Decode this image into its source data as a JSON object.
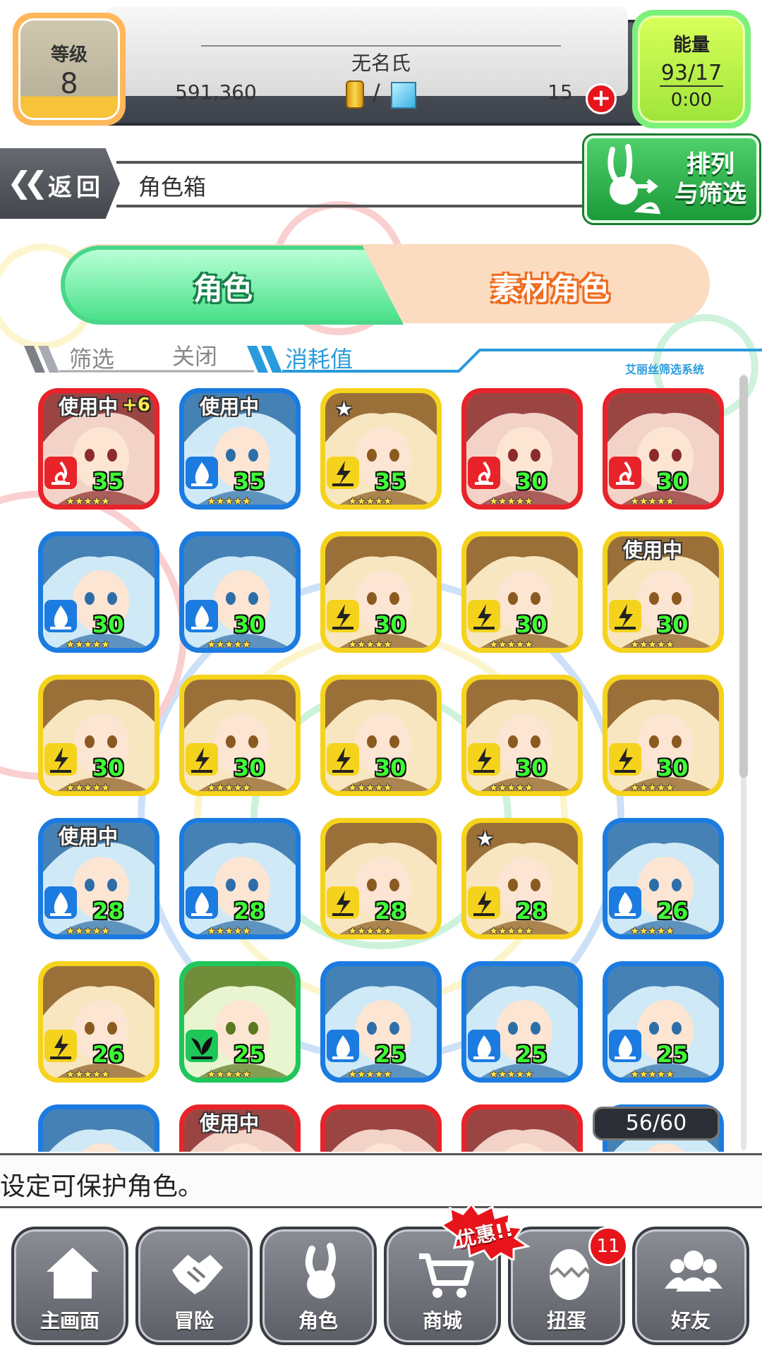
{
  "status": {
    "level_label": "等级",
    "level": "8",
    "username": "无名氏",
    "coins": "591,360",
    "separator": "/",
    "gems": "15",
    "energy_label": "能量",
    "energy": "93/17",
    "energy_timer": "0:00"
  },
  "header": {
    "back_label": "返回",
    "title": "角色箱",
    "sort_label_1": "排列",
    "sort_label_2": "与筛选"
  },
  "tabs": [
    {
      "label": "角色",
      "active": true
    },
    {
      "label": "素材角色",
      "active": false
    }
  ],
  "filter": {
    "filter_label": "筛选",
    "filter_state": "关闭",
    "sort_key": "消耗值",
    "system_label": "艾丽丝筛选系统"
  },
  "characters": [
    {
      "frame": "red",
      "element": "fire",
      "cost": "35",
      "in_use": "使用中",
      "plus": "+6"
    },
    {
      "frame": "blue",
      "element": "water",
      "cost": "35",
      "in_use": "使用中"
    },
    {
      "frame": "yellow",
      "element": "thunder",
      "cost": "35",
      "favorite": true
    },
    {
      "frame": "red",
      "element": "fire",
      "cost": "30"
    },
    {
      "frame": "red",
      "element": "fire",
      "cost": "30"
    },
    {
      "frame": "blue",
      "element": "water",
      "cost": "30"
    },
    {
      "frame": "blue",
      "element": "water",
      "cost": "30"
    },
    {
      "frame": "yellow",
      "element": "thunder",
      "cost": "30"
    },
    {
      "frame": "yellow",
      "element": "thunder",
      "cost": "30"
    },
    {
      "frame": "yellow",
      "element": "thunder",
      "cost": "30",
      "in_use": "使用中"
    },
    {
      "frame": "yellow",
      "element": "thunder",
      "cost": "30"
    },
    {
      "frame": "yellow",
      "element": "thunder",
      "cost": "30"
    },
    {
      "frame": "yellow",
      "element": "thunder",
      "cost": "30"
    },
    {
      "frame": "yellow",
      "element": "thunder",
      "cost": "30"
    },
    {
      "frame": "yellow",
      "element": "thunder",
      "cost": "30"
    },
    {
      "frame": "blue",
      "element": "water",
      "cost": "28",
      "in_use": "使用中"
    },
    {
      "frame": "blue",
      "element": "water",
      "cost": "28"
    },
    {
      "frame": "yellow",
      "element": "thunder",
      "cost": "28"
    },
    {
      "frame": "yellow",
      "element": "thunder",
      "cost": "28",
      "favorite": true
    },
    {
      "frame": "blue",
      "element": "water",
      "cost": "26"
    },
    {
      "frame": "yellow",
      "element": "thunder",
      "cost": "26"
    },
    {
      "frame": "green",
      "element": "wood",
      "cost": "25"
    },
    {
      "frame": "blue",
      "element": "water",
      "cost": "25"
    },
    {
      "frame": "blue",
      "element": "water",
      "cost": "25"
    },
    {
      "frame": "blue",
      "element": "water",
      "cost": "25"
    },
    {
      "frame": "blue",
      "element": "water",
      "cost": ""
    },
    {
      "frame": "red",
      "element": "fire",
      "cost": "",
      "in_use": "使用中"
    },
    {
      "frame": "red",
      "element": "fire",
      "cost": ""
    },
    {
      "frame": "red",
      "element": "fire",
      "cost": ""
    },
    {
      "frame": "blue",
      "element": "water",
      "cost": ""
    }
  ],
  "box_count": "56/60",
  "hint": "设定可保护角色。",
  "nav": {
    "home": "主画面",
    "quest": "冒险",
    "characters": "角色",
    "shop": "商城",
    "gacha": "扭蛋",
    "friends": "好友",
    "sale_badge": "优惠!!",
    "gacha_count": "11"
  },
  "colors": {
    "red": "#e8232a",
    "blue": "#1b7be0",
    "yellow": "#f5d31c",
    "green": "#1fc65a",
    "cost_text": "#3cff33",
    "tab_active": "#4ae08a",
    "tab_inactive": "#fbdcc0"
  }
}
